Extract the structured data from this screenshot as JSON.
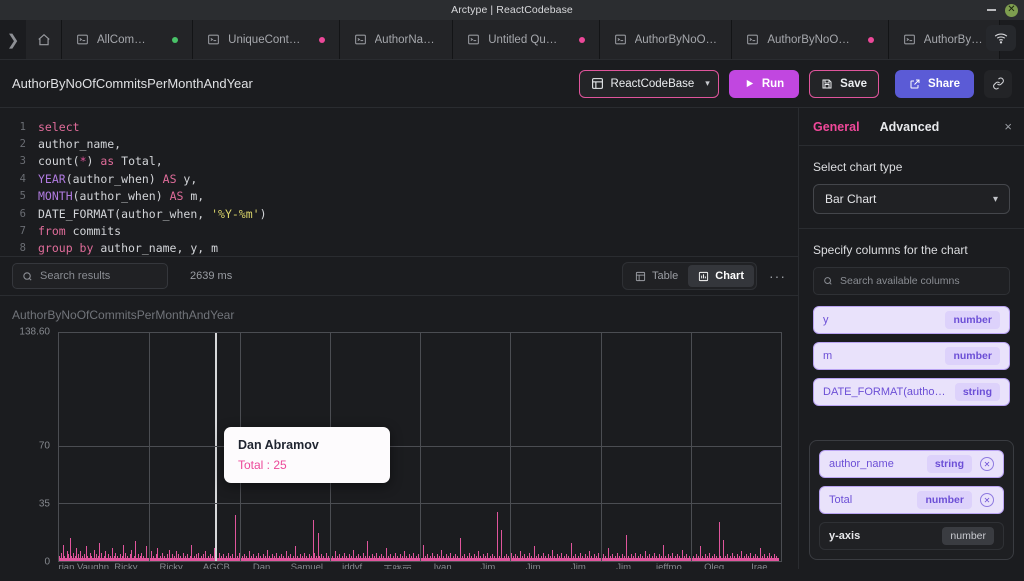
{
  "window": {
    "title": "Arctype | ReactCodebase",
    "minimize_label": "–",
    "close_label": "×"
  },
  "tabbar": {
    "expand_icon": "chevron-right-icon",
    "home_icon": "home-icon",
    "add_label": "+",
    "wifi_icon": "wifi-icon",
    "tabs": [
      {
        "label": "AllCommits",
        "dot": "green"
      },
      {
        "label": "UniqueContrib",
        "dot": "pink"
      },
      {
        "label": "AuthorName",
        "dot": "none"
      },
      {
        "label": "Untitled Query",
        "dot": "pink"
      },
      {
        "label": "AuthorByNoOf...",
        "dot": "none"
      },
      {
        "label": "AuthorByNoOf...",
        "dot": "pink"
      },
      {
        "label": "AuthorByNo",
        "dot": "none"
      }
    ]
  },
  "toolbar": {
    "query_name": "AuthorByNoOfCommitsPerMonthAndYear",
    "database_label": "ReactCodeBase",
    "database_chevron": "⌄",
    "run_label": "Run",
    "save_label": "Save",
    "share_label": "Share",
    "link_icon": "link-icon",
    "accent_pink": "#e0559c",
    "accent_purple": "#c147e0",
    "accent_blue": "#5b5bd6"
  },
  "editor": {
    "lines": [
      {
        "n": "1",
        "tokens": [
          {
            "t": "select",
            "c": "kw"
          }
        ]
      },
      {
        "n": "2",
        "tokens": [
          {
            "t": "author_name,",
            "c": "plain"
          }
        ]
      },
      {
        "n": "3",
        "tokens": [
          {
            "t": "count",
            "c": "plain"
          },
          {
            "t": "(",
            "c": "plain"
          },
          {
            "t": "*",
            "c": "op"
          },
          {
            "t": ") ",
            "c": "plain"
          },
          {
            "t": "as",
            "c": "kw"
          },
          {
            "t": " Total,",
            "c": "plain"
          }
        ]
      },
      {
        "n": "4",
        "tokens": [
          {
            "t": "YEAR",
            "c": "fn"
          },
          {
            "t": "(author_when) ",
            "c": "plain"
          },
          {
            "t": "AS",
            "c": "kw"
          },
          {
            "t": " y,",
            "c": "plain"
          }
        ]
      },
      {
        "n": "5",
        "tokens": [
          {
            "t": "MONTH",
            "c": "fn"
          },
          {
            "t": "(author_when) ",
            "c": "plain"
          },
          {
            "t": "AS",
            "c": "kw"
          },
          {
            "t": " m,",
            "c": "plain"
          }
        ]
      },
      {
        "n": "6",
        "tokens": [
          {
            "t": "DATE_FORMAT",
            "c": "plain"
          },
          {
            "t": "(author_when, ",
            "c": "plain"
          },
          {
            "t": "'%Y-%m'",
            "c": "str"
          },
          {
            "t": ")",
            "c": "plain"
          }
        ]
      },
      {
        "n": "7",
        "tokens": [
          {
            "t": "from",
            "c": "kw"
          },
          {
            "t": " commits",
            "c": "plain"
          }
        ]
      },
      {
        "n": "8",
        "tokens": [
          {
            "t": "group by",
            "c": "kw"
          },
          {
            "t": " author_name, y, m",
            "c": "plain"
          }
        ]
      }
    ]
  },
  "results": {
    "search_placeholder": "Search results",
    "search_value": "",
    "timing": "2639 ms",
    "table_label": "Table",
    "chart_label": "Chart",
    "active_view": "Chart",
    "more_label": "···"
  },
  "panel": {
    "tab_general": "General",
    "tab_advanced": "Advanced",
    "active_tab": "General",
    "close_label": "×",
    "chart_type_label": "Select chart type",
    "chart_type_value": "Bar Chart",
    "columns_label": "Specify columns for the chart",
    "columns_search_placeholder": "Search available columns",
    "available_columns": [
      {
        "name": "y",
        "type": "number"
      },
      {
        "name": "m",
        "type": "number"
      },
      {
        "name": "DATE_FORMAT(author_w…",
        "type": "string"
      }
    ],
    "selected_columns": [
      {
        "name": "author_name",
        "type": "string"
      },
      {
        "name": "Total",
        "type": "number"
      }
    ],
    "axis_rows": [
      {
        "name": "y-axis",
        "type": "number"
      }
    ]
  },
  "tooltip": {
    "name": "Dan Abramov",
    "metric_label": "Total",
    "metric_value": "25",
    "text": "Total : 25"
  },
  "chart_data": {
    "type": "bar",
    "title": "AuthorByNoOfCommitsPerMonthAndYear",
    "xlabel": "",
    "ylabel": "",
    "ylim": [
      0,
      138.6
    ],
    "grid": true,
    "legend": "none",
    "yticks": [
      {
        "value": 138.6,
        "label": "138.60"
      },
      {
        "value": 70,
        "label": "70"
      },
      {
        "value": 35,
        "label": "35"
      },
      {
        "value": 0,
        "label": "0"
      }
    ],
    "xtick_labels": [
      "Brian Vaughn",
      "Ricky",
      "Ricky",
      "AGCB",
      "Dan",
      "Samuel",
      "iddyf",
      "王晓丽",
      "Ivan",
      "Jim",
      "Jim",
      "Jim",
      "Jim",
      "jeffmo",
      "Oleg",
      "Irae"
    ],
    "highlighted_category": "Dan Abramov",
    "highlighted_value": 25,
    "bar_color": "#e0559c",
    "values": [
      3,
      1,
      2,
      1,
      5,
      1,
      2,
      10,
      1,
      3,
      1,
      2,
      1,
      6,
      2,
      1,
      4,
      1,
      2,
      14,
      1,
      3,
      2,
      1,
      5,
      1,
      2,
      1,
      3,
      1,
      8,
      2,
      1,
      4,
      1,
      2,
      6,
      1,
      2,
      1,
      3,
      1,
      2,
      1,
      4,
      1,
      2,
      9,
      1,
      3,
      1,
      2,
      1,
      5,
      2,
      1,
      3,
      1,
      2,
      1,
      7,
      1,
      2,
      1,
      4,
      1,
      2,
      1,
      3,
      11,
      1,
      2,
      1,
      5,
      1,
      2,
      1,
      3,
      1,
      2,
      6,
      1,
      2,
      1,
      4,
      1,
      2,
      1,
      3,
      1,
      2,
      8,
      1,
      2,
      1,
      3,
      1,
      5,
      1,
      2,
      1,
      3,
      1,
      2,
      1,
      4,
      1,
      2,
      1,
      3,
      10,
      1,
      2,
      1,
      5,
      1,
      2,
      1,
      3,
      1,
      2,
      1,
      4,
      1,
      2,
      7,
      1,
      2,
      1,
      3,
      1,
      2,
      12,
      1,
      2,
      1,
      4,
      1,
      2,
      1,
      3,
      1,
      5,
      1,
      2,
      1,
      3,
      1,
      2,
      1,
      4,
      9,
      1,
      2,
      1,
      3,
      1,
      2,
      1,
      6,
      1,
      2,
      1,
      3,
      1,
      2,
      1,
      4,
      1,
      2,
      8,
      1,
      2,
      1,
      3,
      1,
      2,
      1,
      5,
      1,
      2,
      1,
      3,
      1,
      2,
      1,
      4,
      1,
      2,
      1,
      3,
      7,
      1,
      2,
      1,
      4,
      1,
      2,
      1,
      3,
      2,
      1,
      6,
      1,
      2,
      1,
      4,
      1,
      2,
      1,
      3,
      1,
      2,
      1,
      5,
      1,
      2,
      1,
      3,
      1,
      2,
      1,
      4,
      1,
      2,
      1,
      3,
      1,
      2,
      10,
      1,
      2,
      1,
      3,
      1,
      2,
      1,
      4,
      1,
      2,
      1,
      5,
      1,
      2,
      1,
      3,
      1,
      2,
      1,
      4,
      1,
      2,
      1,
      6,
      1,
      2,
      1,
      3,
      1,
      2,
      1,
      4,
      1,
      2,
      1,
      3,
      1,
      2,
      8,
      1,
      2,
      1,
      3,
      1,
      2,
      1,
      5,
      1,
      2,
      1,
      3,
      1,
      2,
      1,
      4,
      1,
      2,
      1,
      3,
      1,
      2,
      1,
      5,
      1,
      2,
      1,
      3,
      1,
      2,
      1,
      4,
      1,
      2,
      1,
      28,
      1,
      2,
      1,
      3,
      1,
      2,
      1,
      5,
      1,
      2,
      1,
      3,
      1,
      2,
      1,
      4,
      1,
      2,
      1,
      3,
      1,
      2,
      1,
      6,
      1,
      2,
      1,
      3,
      1,
      2,
      1,
      4,
      1,
      2,
      1,
      3,
      1,
      2,
      1,
      5,
      1,
      2,
      1,
      3,
      1,
      2,
      1,
      4,
      1,
      2,
      1,
      3,
      1,
      2,
      1,
      7,
      1,
      2,
      1,
      3,
      1,
      2,
      1,
      4,
      1,
      2,
      1,
      3,
      1,
      2,
      1,
      5,
      1,
      2,
      1,
      3,
      1,
      2,
      1,
      4,
      1,
      2,
      1,
      3,
      1,
      2,
      1,
      6,
      1,
      2,
      1,
      3,
      1,
      2,
      1,
      4,
      1,
      2,
      1,
      3,
      1,
      2,
      1,
      9,
      1,
      2,
      1,
      3,
      1,
      2,
      1,
      4,
      1,
      2,
      1,
      3,
      1,
      2,
      1,
      5,
      1,
      2,
      1,
      3,
      1,
      2,
      1,
      4,
      1,
      2,
      1,
      3,
      1,
      2,
      1,
      25,
      5,
      2,
      1,
      3,
      1,
      2,
      1,
      17,
      3,
      1,
      2,
      1,
      4,
      1,
      2,
      1,
      3,
      1,
      2,
      1,
      5,
      1,
      2,
      1,
      3,
      1,
      2,
      1,
      4,
      1,
      2,
      1,
      3,
      1,
      2,
      1,
      6,
      1,
      2,
      1,
      3,
      1,
      2,
      1,
      4,
      1,
      2,
      1,
      3,
      1,
      2,
      1,
      5,
      1,
      2,
      1,
      3,
      1,
      2,
      1,
      4,
      1,
      2,
      1,
      3,
      1,
      2,
      1,
      7,
      1,
      2,
      1,
      3,
      1,
      2,
      1,
      4,
      1,
      2,
      1,
      3,
      1,
      2,
      1,
      5,
      1,
      2,
      1,
      3,
      1,
      2,
      1,
      12,
      1,
      2,
      1,
      3,
      1,
      2,
      1,
      4,
      1,
      2,
      1,
      3,
      1,
      2,
      1,
      5,
      1,
      2,
      1,
      3,
      1,
      2,
      1,
      4,
      1,
      2,
      1,
      3,
      1,
      2,
      1,
      8,
      1,
      2,
      1,
      3,
      1,
      2,
      1,
      4,
      1,
      2,
      1,
      3,
      1,
      2,
      1,
      5,
      1,
      2,
      1,
      3,
      1,
      2,
      1,
      4,
      1,
      2,
      1,
      3,
      1,
      2,
      1,
      6,
      1,
      2,
      1,
      3,
      1,
      2,
      1,
      4,
      1,
      2,
      1,
      3,
      1,
      2,
      1,
      5,
      1,
      2,
      1,
      3,
      1,
      2,
      1,
      4,
      1,
      2,
      1,
      3,
      1,
      2,
      1,
      10,
      1,
      2,
      1,
      3,
      1,
      2,
      1,
      4,
      1,
      2,
      1,
      3,
      1,
      2,
      1,
      5,
      1,
      2,
      1,
      3,
      1,
      2,
      1,
      4,
      1,
      2,
      1,
      3,
      1,
      2,
      1,
      7,
      1,
      2,
      1,
      3,
      1,
      2,
      1,
      4,
      1,
      2,
      1,
      3,
      1,
      2,
      1,
      5,
      1,
      2,
      1,
      3,
      1,
      2,
      1,
      4,
      1,
      2,
      1,
      3,
      1,
      2,
      1,
      14,
      1,
      2,
      1,
      3,
      1,
      2,
      1,
      4,
      1,
      2,
      1,
      3,
      1,
      2,
      1,
      5,
      1,
      2,
      1,
      3,
      1,
      2,
      1,
      4,
      1,
      2,
      1,
      3,
      1,
      2,
      1,
      6,
      1,
      2,
      1,
      3,
      1,
      2,
      1,
      4,
      1,
      2,
      1,
      3,
      1,
      2,
      1,
      5,
      1,
      2,
      1,
      3,
      1,
      2,
      1,
      4,
      1,
      2,
      1,
      3,
      1,
      2,
      1,
      30,
      4,
      2,
      1,
      3,
      1,
      2,
      1,
      19,
      1,
      2,
      1,
      3,
      1,
      2,
      1,
      4,
      1,
      2,
      1,
      3,
      1,
      2,
      1,
      5,
      1,
      2,
      1,
      3,
      1,
      2,
      1,
      4,
      1,
      2,
      1,
      3,
      1,
      2,
      1,
      6,
      1,
      2,
      1,
      3,
      1,
      2,
      1,
      4,
      1,
      2,
      1,
      3,
      1,
      2,
      1,
      5,
      1,
      2,
      1,
      3,
      1,
      2,
      1,
      9,
      1,
      2,
      1,
      3,
      1,
      2,
      1,
      4,
      1,
      2,
      1,
      3,
      1,
      2,
      1,
      5,
      1,
      2,
      1,
      3,
      1,
      2,
      1,
      4,
      1,
      2,
      1,
      3,
      1,
      2,
      1,
      7,
      1,
      2,
      1,
      3,
      1,
      2,
      1,
      4,
      1,
      2,
      1,
      3,
      1,
      2,
      1,
      5,
      1,
      2,
      1,
      3,
      1,
      2,
      1,
      4,
      1,
      2,
      1,
      3,
      1,
      2,
      1,
      11,
      1,
      2,
      1,
      3,
      1,
      2,
      1,
      4,
      1,
      2,
      1,
      3,
      1,
      2,
      1,
      5,
      1,
      2,
      1,
      3,
      1,
      2,
      1,
      4,
      1,
      2,
      1,
      3,
      1,
      2,
      1,
      6,
      1,
      2,
      1,
      3,
      1,
      2,
      1,
      4,
      1,
      2,
      1,
      3,
      1,
      2,
      1,
      5,
      1,
      2,
      1,
      3,
      1,
      2,
      1,
      4,
      1,
      2,
      1,
      3,
      1,
      2,
      1,
      8,
      1,
      2,
      1,
      3,
      1,
      2,
      1,
      4,
      1,
      2,
      1,
      3,
      1,
      2,
      1,
      5,
      1,
      2,
      1,
      3,
      1,
      2,
      1,
      4,
      1,
      2,
      1,
      3,
      1,
      2,
      1,
      16,
      1,
      2,
      1,
      3,
      1,
      2,
      1,
      4,
      1,
      2,
      1,
      3,
      1,
      2,
      1,
      5,
      1,
      2,
      1,
      3,
      1,
      2,
      1,
      4,
      1,
      2,
      1,
      3,
      1,
      2,
      1,
      6,
      1,
      2,
      1,
      3,
      1,
      2,
      1,
      4,
      1,
      2,
      1,
      3,
      1,
      2,
      1,
      5,
      1,
      2,
      1,
      3,
      1,
      2,
      1,
      4,
      1,
      2,
      1,
      3,
      1,
      2,
      1,
      10,
      1,
      2,
      1,
      3,
      1,
      2,
      1,
      4,
      1,
      2,
      1,
      3,
      1,
      2,
      1,
      5,
      1,
      2,
      1,
      3,
      1,
      2,
      1,
      4,
      1,
      2,
      1,
      3,
      1,
      2,
      1,
      7,
      1,
      2,
      1,
      3,
      1,
      2,
      1,
      4,
      1,
      2,
      1,
      3,
      1,
      2,
      1,
      5,
      1,
      2,
      1,
      3,
      1,
      2,
      1,
      4,
      1,
      2,
      1,
      3,
      1,
      2,
      1,
      9,
      1,
      2,
      1,
      3,
      1,
      2,
      1,
      4,
      1,
      2,
      1,
      3,
      1,
      2,
      1,
      5,
      1,
      2,
      1,
      3,
      1,
      2,
      1,
      4,
      1,
      2,
      1,
      3,
      1,
      2,
      1,
      24,
      2,
      1,
      3,
      1,
      2,
      1,
      13,
      1,
      2,
      1,
      3,
      1,
      2,
      1,
      4,
      1,
      2,
      1,
      3,
      1,
      2,
      1,
      5,
      1,
      2,
      1,
      3,
      1,
      2,
      1,
      4,
      1,
      2,
      1,
      3,
      1,
      2,
      1,
      6,
      1,
      2,
      1,
      3,
      1,
      2,
      1,
      4,
      1,
      2,
      1,
      3,
      1,
      2,
      1,
      5,
      1,
      2,
      1,
      3,
      1,
      2,
      1,
      4,
      1,
      2,
      1,
      3,
      1,
      2,
      1,
      8,
      1,
      2,
      1,
      3,
      1,
      2,
      1,
      4,
      1,
      2,
      1,
      3,
      1,
      2,
      1,
      5,
      1,
      2,
      1,
      3,
      1,
      2,
      1,
      4,
      1,
      2,
      1,
      3,
      1,
      2,
      1
    ]
  }
}
